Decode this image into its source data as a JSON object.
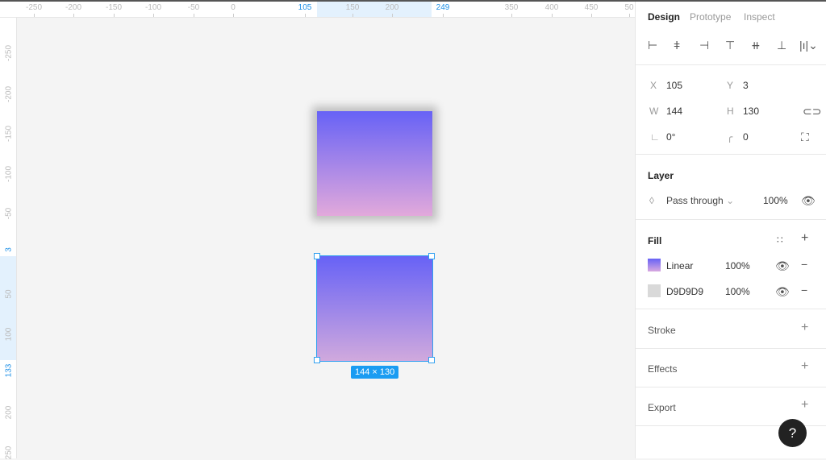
{
  "ruler_top": {
    "ticks": [
      {
        "label": "-250"
      },
      {
        "label": "-200"
      },
      {
        "label": "-150"
      },
      {
        "label": "-100"
      },
      {
        "label": "-50"
      },
      {
        "label": "0"
      },
      {
        "label": "105",
        "highlight": true
      },
      {
        "label": "150"
      },
      {
        "label": "200"
      },
      {
        "label": "249",
        "highlight": true
      },
      {
        "label": "350"
      },
      {
        "label": "400"
      },
      {
        "label": "450"
      },
      {
        "label": "50"
      }
    ]
  },
  "ruler_left": {
    "ticks": [
      {
        "label": "-250"
      },
      {
        "label": "-200"
      },
      {
        "label": "-150"
      },
      {
        "label": "-100"
      },
      {
        "label": "-50"
      },
      {
        "label": "3",
        "highlight": true
      },
      {
        "label": "50"
      },
      {
        "label": "100"
      },
      {
        "label": "133",
        "highlight": true
      },
      {
        "label": "200"
      },
      {
        "label": "250"
      }
    ]
  },
  "canvas": {
    "selection_size": "144 × 130",
    "gradient_start": "#6762f6",
    "gradient_end": "#d0a9dd",
    "selection_color": "#30a0f0"
  },
  "panel": {
    "tabs": [
      "Design",
      "Prototype",
      "Inspect"
    ],
    "position": {
      "x_label": "X",
      "x": "105",
      "y_label": "Y",
      "y": "3",
      "w_label": "W",
      "w": "144",
      "h_label": "H",
      "h": "130",
      "rotation": "0°",
      "radius": "0"
    },
    "layer": {
      "title": "Layer",
      "blend": "Pass through",
      "opacity": "100%"
    },
    "fill": {
      "title": "Fill",
      "items": [
        {
          "name": "Linear",
          "opacity": "100%"
        },
        {
          "name": "D9D9D9",
          "opacity": "100%"
        }
      ]
    },
    "stroke": {
      "title": "Stroke"
    },
    "effects": {
      "title": "Effects"
    },
    "export": {
      "title": "Export"
    }
  },
  "help": {
    "label": "?"
  }
}
